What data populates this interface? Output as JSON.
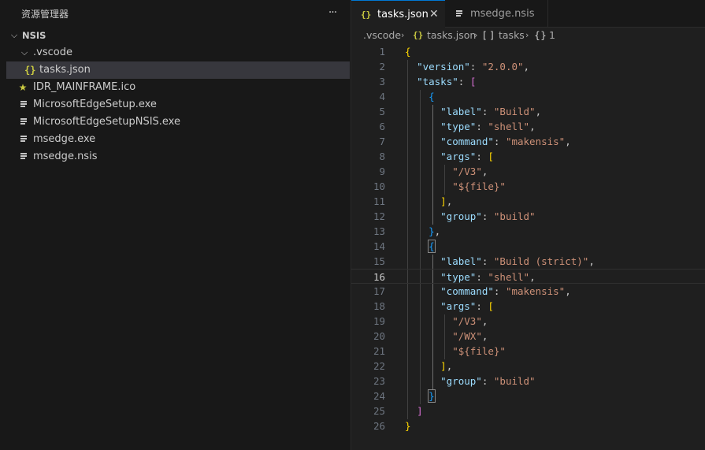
{
  "explorer": {
    "title": "资源管理器",
    "more_label": "···",
    "root": "NSIS",
    "items": [
      {
        "label": ".vscode",
        "icon": "chevron-down-icon"
      },
      {
        "label": "tasks.json",
        "icon": "json-braces-icon",
        "icon_text": "{}"
      },
      {
        "label": "IDR_MAINFRAME.ico",
        "icon": "star-icon",
        "icon_text": "★"
      },
      {
        "label": "MicrosoftEdgeSetup.exe",
        "icon": "file-lines-icon"
      },
      {
        "label": "MicrosoftEdgeSetupNSIS.exe",
        "icon": "file-lines-icon"
      },
      {
        "label": "msedge.exe",
        "icon": "file-lines-icon"
      },
      {
        "label": "msedge.nsis",
        "icon": "file-lines-icon"
      }
    ]
  },
  "tabs": [
    {
      "label": "tasks.json",
      "icon_text": "{}",
      "close": "✕",
      "active": true
    },
    {
      "label": "msedge.nsis",
      "active": false
    }
  ],
  "breadcrumb": {
    "folder": ".vscode",
    "file": "tasks.json",
    "file_icon": "{}",
    "arr_icon": "[ ]",
    "arr": "tasks",
    "obj_icon": "{}",
    "obj": "1",
    "sep": "›"
  },
  "editor": {
    "current_line": 16,
    "lines": [
      {
        "n": "1"
      },
      {
        "n": "2"
      },
      {
        "n": "3"
      },
      {
        "n": "4"
      },
      {
        "n": "5"
      },
      {
        "n": "6"
      },
      {
        "n": "7"
      },
      {
        "n": "8"
      },
      {
        "n": "9"
      },
      {
        "n": "10"
      },
      {
        "n": "11"
      },
      {
        "n": "12"
      },
      {
        "n": "13"
      },
      {
        "n": "14"
      },
      {
        "n": "15"
      },
      {
        "n": "16"
      },
      {
        "n": "17"
      },
      {
        "n": "18"
      },
      {
        "n": "19"
      },
      {
        "n": "20"
      },
      {
        "n": "21"
      },
      {
        "n": "22"
      },
      {
        "n": "23"
      },
      {
        "n": "24"
      },
      {
        "n": "25"
      },
      {
        "n": "26"
      }
    ],
    "code": {
      "open": "{",
      "version_key": "\"version\"",
      "version_val": "\"2.0.0\"",
      "tasks_key": "\"tasks\"",
      "label_key": "\"label\"",
      "type_key": "\"type\"",
      "command_key": "\"command\"",
      "args_key": "\"args\"",
      "group_key": "\"group\"",
      "label1": "\"Build\"",
      "label2": "\"Build (strict)\"",
      "shell": "\"shell\"",
      "makensis": "\"makensis\"",
      "v3": "\"/V3\"",
      "wx": "\"/WX\"",
      "file": "\"${file}\"",
      "build": "\"build\"",
      "close": "}"
    }
  },
  "colors": {
    "key": "#9cdcfe",
    "string": "#ce9178",
    "bracket_gold": "#ffd700",
    "bracket_purple": "#da70d6",
    "bracket_blue": "#179fff",
    "tab_accent": "#0078d4"
  }
}
